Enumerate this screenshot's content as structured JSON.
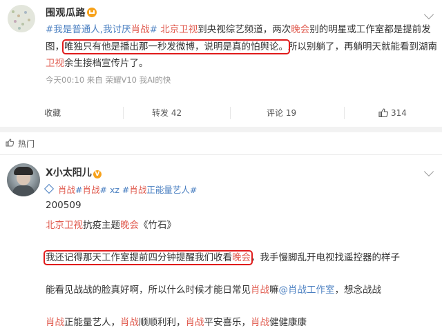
{
  "post": {
    "username": "围观瓜路",
    "lines": [
      [
        {
          "t": "#我是普通人,我讨厌",
          "c": "blue"
        },
        {
          "t": "肖战",
          "c": "red"
        },
        {
          "t": "#",
          "c": "blue"
        },
        {
          "t": " ",
          "c": ""
        },
        {
          "t": "北京卫视",
          "c": "red"
        },
        {
          "t": "到央视综艺频道，两次",
          "c": ""
        },
        {
          "t": "晚会",
          "c": "red"
        },
        {
          "t": "别的明星或工作室都是提前发",
          "c": ""
        }
      ],
      [
        {
          "t": "图，",
          "c": ""
        },
        {
          "t": "唯独只有他是播出那一秒发微博，说明是真的怕舆论。",
          "c": "",
          "boxed": true
        },
        {
          "t": "所以别躺了，再躺明天就能看到湖南",
          "c": ""
        }
      ],
      [
        {
          "t": "卫视",
          "c": "red"
        },
        {
          "t": "余生接档宣传片了。",
          "c": ""
        }
      ]
    ],
    "meta": "今天00:10  来自 荣耀V10 我AI的快",
    "actions": {
      "favorite": "收藏",
      "repost": "转发 42",
      "comment": "评论 19",
      "like": "314"
    }
  },
  "hot_section": {
    "label": "热门"
  },
  "comment": {
    "username": "X小太阳儿",
    "vbadge": "V",
    "bio": [
      {
        "t": "肖战",
        "c": "red"
      },
      {
        "t": "#",
        "c": "blue"
      },
      {
        "t": "肖战",
        "c": "red"
      },
      {
        "t": "# xz #",
        "c": "blue"
      },
      {
        "t": "肖战",
        "c": "red"
      },
      {
        "t": "正能量艺人#",
        "c": "blue"
      }
    ],
    "date": "200509",
    "line2": [
      {
        "t": "北京卫视",
        "c": "red"
      },
      {
        "t": "抗疫主题",
        "c": ""
      },
      {
        "t": "晚会",
        "c": "red"
      },
      {
        "t": "《竹石》",
        "c": ""
      }
    ],
    "line3": [
      {
        "t": "我还记得那天工作室提前四分钟提醒我们收看",
        "c": "",
        "boxed_start": true
      },
      {
        "t": "晚会",
        "c": "red",
        "boxed_end": true
      },
      {
        "t": "，我手慢脚乱开电视找遥控器的样子",
        "c": ""
      }
    ],
    "line4": [
      {
        "t": "能看见战战的脸真好啊，所以什么时候才能日常见",
        "c": ""
      },
      {
        "t": "肖战",
        "c": "red"
      },
      {
        "t": "嘛",
        "c": ""
      },
      {
        "t": "@肖战工作室",
        "c": "blue"
      },
      {
        "t": "，想念战战",
        "c": ""
      }
    ],
    "line5": [
      {
        "t": "肖战",
        "c": "red"
      },
      {
        "t": "正能量艺人，",
        "c": ""
      },
      {
        "t": "肖战",
        "c": "red"
      },
      {
        "t": "顺顺利利，",
        "c": ""
      },
      {
        "t": "肖战",
        "c": "red"
      },
      {
        "t": "平安喜乐，",
        "c": ""
      },
      {
        "t": "肖战",
        "c": "red"
      },
      {
        "t": "健健康康",
        "c": ""
      }
    ]
  },
  "colors": {
    "link_blue": "#4a7fc1",
    "keyword_red": "#e05a4e",
    "highlight_box": "#e01b1b",
    "badge_orange": "#f7a21b"
  }
}
